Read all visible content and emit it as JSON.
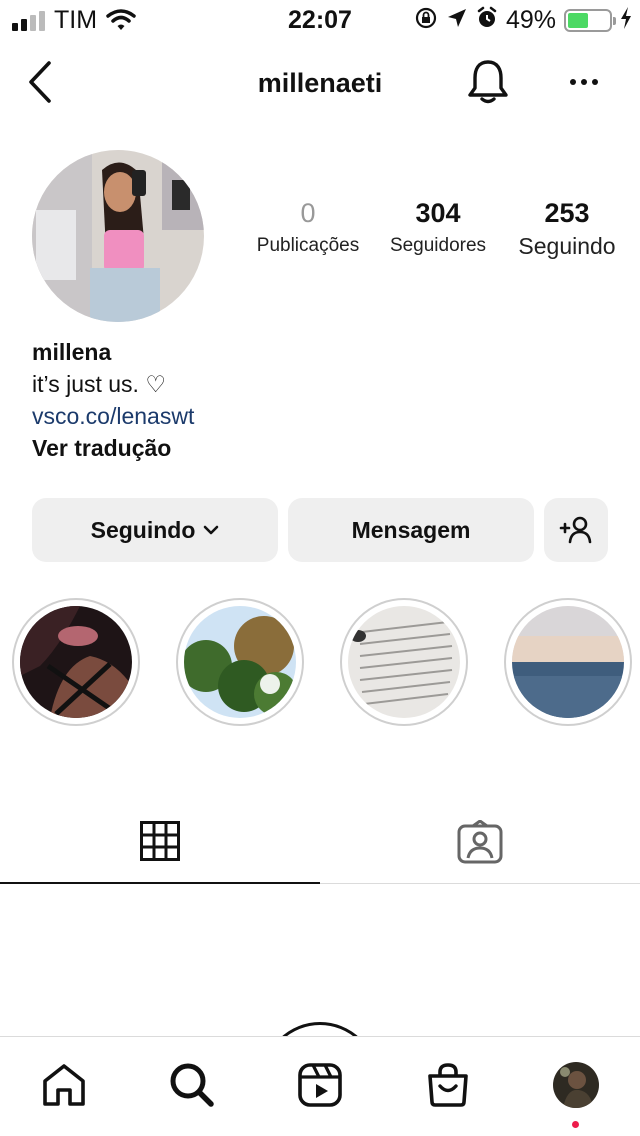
{
  "status_bar": {
    "carrier": "TIM",
    "time": "22:07",
    "battery_percent": "49%",
    "battery_level": 0.49,
    "icons": [
      "signal-icon",
      "wifi-icon",
      "orientation-lock-icon",
      "location-arrow-icon",
      "alarm-icon",
      "battery-icon",
      "charging-bolt-icon"
    ]
  },
  "header": {
    "username": "millenaeti",
    "icons": [
      "back-chevron-icon",
      "bell-icon",
      "more-dots-icon"
    ]
  },
  "profile": {
    "stats": [
      {
        "value": "0",
        "label": "Publicações"
      },
      {
        "value": "304",
        "label": "Seguidores"
      },
      {
        "value": "253",
        "label": "Seguindo"
      }
    ],
    "name": "millena",
    "bio": "it’s just us. ♡",
    "link": "vsco.co/lenaswt",
    "translate": "Ver tradução"
  },
  "actions": {
    "following_label": "Seguindo",
    "message_label": "Mensagem"
  },
  "highlights": [
    {
      "name": "highlight-portrait"
    },
    {
      "name": "highlight-trees"
    },
    {
      "name": "highlight-book"
    },
    {
      "name": "highlight-ocean"
    }
  ],
  "tabs": [
    {
      "name": "tab-grid",
      "icon": "grid-icon",
      "active": true
    },
    {
      "name": "tab-tagged",
      "icon": "tagged-icon",
      "active": false
    }
  ],
  "bottom_nav": [
    {
      "name": "nav-home",
      "icon": "home-icon"
    },
    {
      "name": "nav-search",
      "icon": "search-icon"
    },
    {
      "name": "nav-reels",
      "icon": "reels-icon"
    },
    {
      "name": "nav-shop",
      "icon": "shop-icon"
    },
    {
      "name": "nav-profile",
      "icon": "profile-avatar-icon"
    }
  ],
  "colors": {
    "link": "#1b3a6b",
    "button_bg": "#efefef",
    "battery": "#4cd964",
    "notification_dot": "#ed1c4b"
  }
}
